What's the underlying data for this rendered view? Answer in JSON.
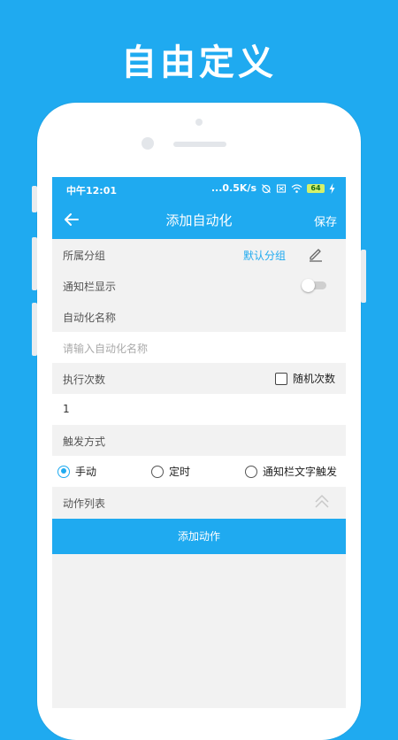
{
  "promo": {
    "title": "自由定义"
  },
  "statusbar": {
    "time": "中午12:01",
    "speed": "...0.5K/s",
    "battery": "64"
  },
  "appbar": {
    "title": "添加自动化",
    "save_label": "保存"
  },
  "form": {
    "group_label": "所属分组",
    "group_value": "默认分组",
    "notification_label": "通知栏显示",
    "notification_enabled": false,
    "name_label": "自动化名称",
    "name_placeholder": "请输入自动化名称",
    "exec_count_label": "执行次数",
    "random_count_label": "随机次数",
    "random_count_checked": false,
    "exec_count_value": "1",
    "trigger_label": "触发方式",
    "trigger_options": [
      "手动",
      "定时",
      "通知栏文字触发"
    ],
    "trigger_selected": "手动",
    "action_list_label": "动作列表",
    "add_action_label": "添加动作"
  },
  "colors": {
    "accent": "#1faaf0",
    "background": "#f2f2f2"
  }
}
